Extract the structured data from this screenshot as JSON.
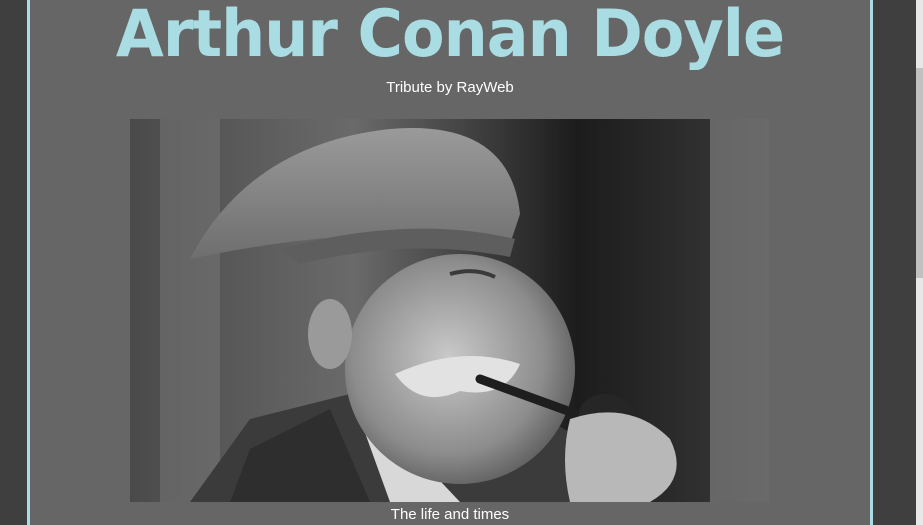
{
  "page": {
    "title": "Arthur Conan Doyle",
    "tagline": "Tribute by RayWeb",
    "caption": "The life and times"
  },
  "portrait": {
    "subject": "Arthur Conan Doyle with pipe and flat cap"
  },
  "colors": {
    "accent": "#a9dde3",
    "panel": "#666666",
    "background": "#3f3f3f"
  }
}
